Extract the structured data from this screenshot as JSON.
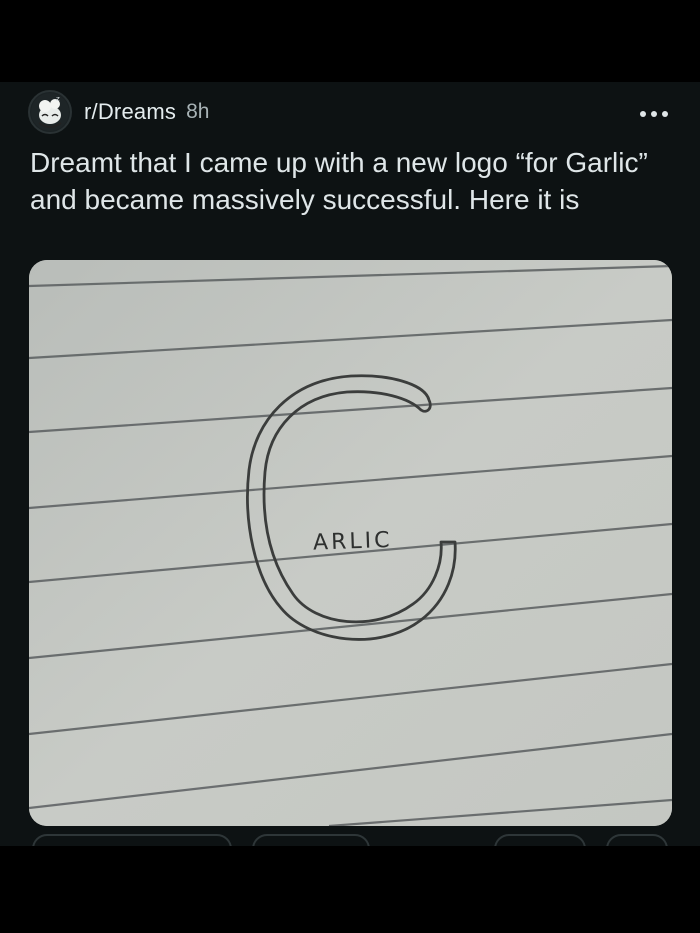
{
  "post": {
    "community": "r/Dreams",
    "age": "8h",
    "title": "Dreamt that I came up with a new logo “for Garlic” and became massively successful. Here it is",
    "avatar_icon": "sleeping-creature-avatar-icon",
    "more_icon": "more-options-icon",
    "image": {
      "description_icon": "notebook-garlic-logo-image",
      "handwritten_text": "ARLIC",
      "big_letter": "G"
    }
  },
  "colors": {
    "background": "#000000",
    "card": "#0d1213",
    "primary_text": "#dfe6e8",
    "secondary_text": "#a7b2b5",
    "paper": "#c3c6c2",
    "ink": "#3b3d3c"
  }
}
